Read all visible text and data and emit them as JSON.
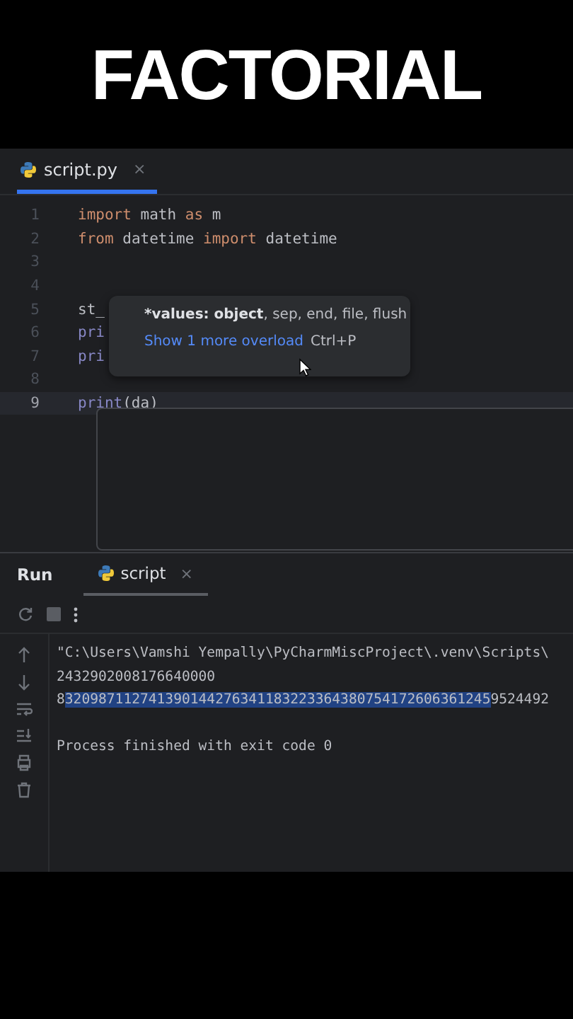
{
  "banner": {
    "title": "FACTORIAL"
  },
  "editor": {
    "tab": {
      "label": "script.py",
      "selected": true,
      "close": "×"
    },
    "lines": [
      {
        "number": "1",
        "current": false,
        "tokens": [
          {
            "kind": "keyword",
            "text": "import"
          },
          {
            "kind": "plain",
            "text": " math "
          },
          {
            "kind": "keyword",
            "text": "as"
          },
          {
            "kind": "plain",
            "text": " m"
          }
        ]
      },
      {
        "number": "2",
        "current": false,
        "tokens": [
          {
            "kind": "keyword",
            "text": "from"
          },
          {
            "kind": "plain",
            "text": " datetime "
          },
          {
            "kind": "keyword",
            "text": "import"
          },
          {
            "kind": "plain",
            "text": " datetime"
          }
        ]
      },
      {
        "number": "3",
        "current": false
      },
      {
        "number": "4",
        "current": false
      },
      {
        "number": "5",
        "current": false,
        "tokens": [
          {
            "kind": "plain",
            "text": "st_"
          }
        ]
      },
      {
        "number": "6",
        "current": false,
        "tokens": [
          {
            "kind": "builtin",
            "text": "pri"
          }
        ]
      },
      {
        "number": "7",
        "current": false,
        "tokens": [
          {
            "kind": "builtin",
            "text": "pri"
          }
        ]
      },
      {
        "number": "8",
        "current": false
      },
      {
        "number": "9",
        "current": true,
        "tokens": [
          {
            "kind": "builtin",
            "text": "print"
          },
          {
            "kind": "plain",
            "text": "(da)"
          }
        ]
      }
    ],
    "hint": {
      "signature_bold": "*values: object",
      "signature_rest": ", sep, end, file, flush",
      "link": "Show 1 more overload",
      "shortcut": "Ctrl+P"
    }
  },
  "run": {
    "title": "Run",
    "tab": {
      "label": "script",
      "selected": true,
      "close": "×"
    },
    "output": [
      {
        "kind": "plain",
        "text": "\"C:\\Users\\Vamshi Yempally\\PyCharmMiscProject\\.venv\\Scripts\\"
      },
      {
        "kind": "plain",
        "text": "2432902008176640000"
      },
      {
        "kind": "selection",
        "before": "8",
        "selected": "320987112741390144276341183223364380754172606361245",
        "after": "9524492"
      },
      {
        "kind": "blank"
      },
      {
        "kind": "plain",
        "text": "Process finished with exit code 0"
      }
    ]
  }
}
